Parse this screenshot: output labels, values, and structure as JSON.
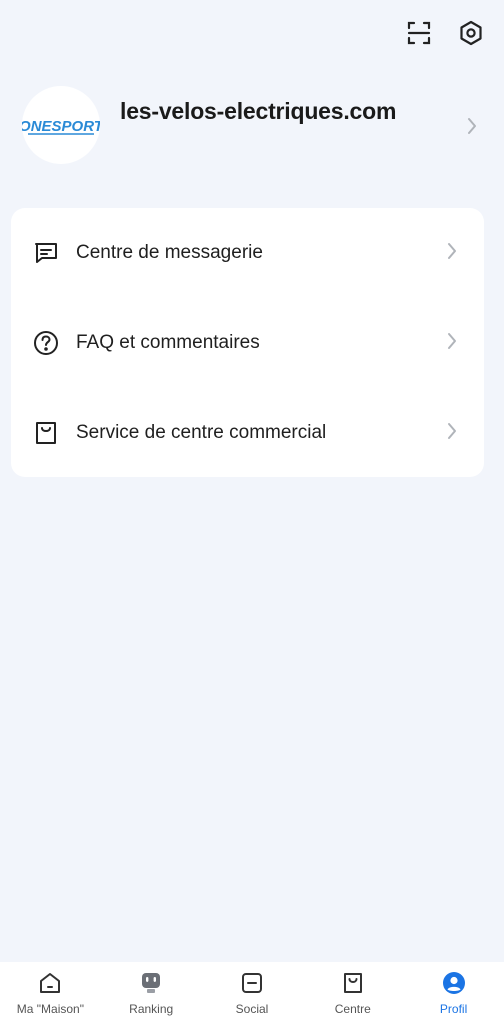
{
  "header": {
    "scan_icon": "scan-icon",
    "settings_icon": "settings-icon"
  },
  "profile": {
    "avatar_logo_text": "ONESPORT",
    "name": "les-velos-electriques.com"
  },
  "menu": {
    "items": [
      {
        "label": "Centre de messagerie",
        "icon": "message-icon"
      },
      {
        "label": "FAQ et commentaires",
        "icon": "help-icon"
      },
      {
        "label": "Service de centre commercial",
        "icon": "shopping-bag-icon"
      }
    ]
  },
  "bottom_nav": {
    "items": [
      {
        "label": "Ma \"Maison\"",
        "icon": "home-icon",
        "active": false
      },
      {
        "label": "Ranking",
        "icon": "robot-icon",
        "active": false
      },
      {
        "label": "Social",
        "icon": "social-icon",
        "active": false
      },
      {
        "label": "Centre",
        "icon": "bag-icon",
        "active": false
      },
      {
        "label": "Profil",
        "icon": "profile-icon",
        "active": true
      }
    ]
  },
  "colors": {
    "background": "#f2f5fb",
    "card": "#ffffff",
    "accent": "#1b74e4",
    "logo_blue": "#2a8ad6"
  }
}
